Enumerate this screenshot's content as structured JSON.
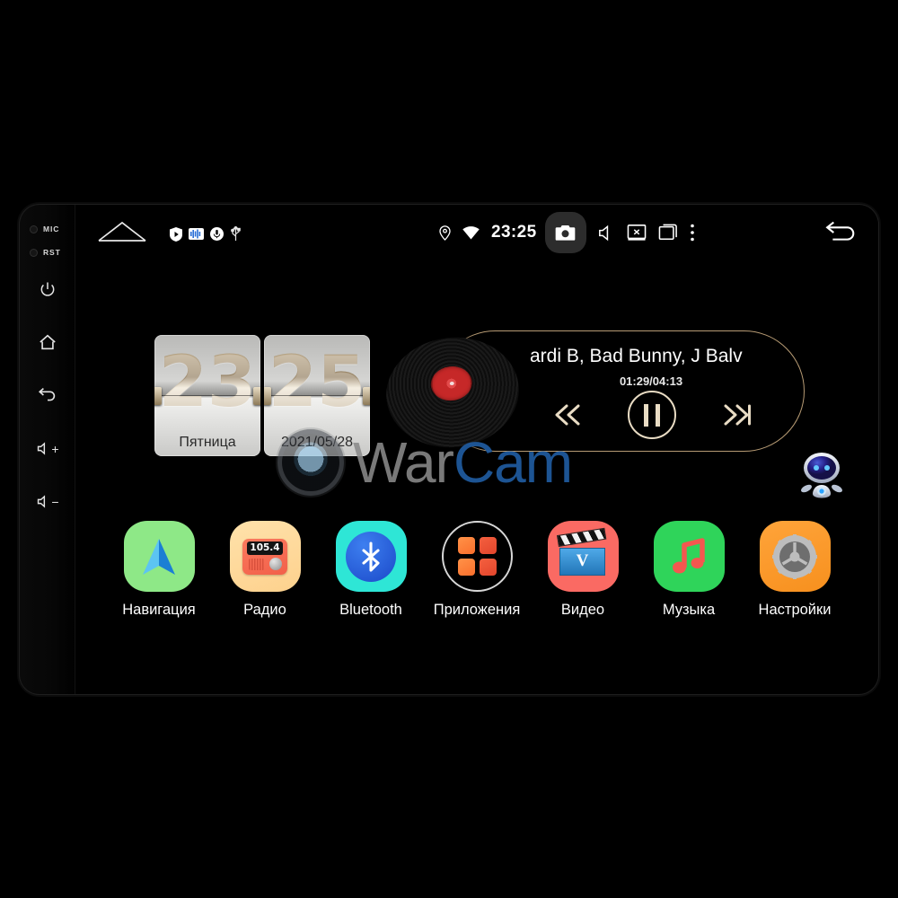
{
  "device": {
    "bezel": {
      "mic_label": "MIC",
      "rst_label": "RST",
      "buttons": [
        {
          "name": "power",
          "glyph": "power-icon"
        },
        {
          "name": "home",
          "glyph": "home-icon"
        },
        {
          "name": "back",
          "glyph": "back-icon"
        },
        {
          "name": "volume-up",
          "glyph": "volume-up-icon",
          "text": "+"
        },
        {
          "name": "volume-down",
          "glyph": "volume-down-icon",
          "text": "−"
        }
      ]
    }
  },
  "statusbar": {
    "tray_icons": [
      "play-shield-icon",
      "equalizer-radio-icon",
      "microphone-icon",
      "usb-icon"
    ],
    "location_icon": "location-pin-icon",
    "wifi_icon": "wifi-icon",
    "time": "23:25",
    "camera_icon": "camera-icon",
    "volume_icon": "speaker-icon",
    "screen_off_icon": "screen-off-icon",
    "recents_icon": "recents-icon",
    "overflow_icon": "more-vertical-icon",
    "back_icon": "back-arrow-icon"
  },
  "clock": {
    "hours": "23",
    "minutes": "25",
    "weekday": "Пятница",
    "date": "2021/05/28"
  },
  "music": {
    "title": "ardi B, Bad Bunny, J Balv",
    "position": "01:29",
    "duration": "04:13",
    "time_display": "01:29/04:13",
    "prev_icon": "previous-track-icon",
    "play_icon": "pause-icon",
    "next_icon": "next-track-icon",
    "accent_color": "#b79b74"
  },
  "assistant": {
    "icon": "robot-assistant-icon"
  },
  "watermark": {
    "text_part1": "War",
    "text_part2": "Cam",
    "color1": "#8a8a8a",
    "color2": "#1f5ba0",
    "logo": "camera-lens-icon"
  },
  "dock": {
    "apps": [
      {
        "label": "Навигация",
        "icon": "navigation-icon",
        "bg": "#8ee887"
      },
      {
        "label": "Радио",
        "icon": "radio-icon",
        "bg": "#ffe2ab",
        "display": "105.4"
      },
      {
        "label": "Bluetooth",
        "icon": "bluetooth-icon",
        "bg": "#2ee6d6"
      },
      {
        "label": "Приложения",
        "icon": "apps-grid-icon",
        "bg": "transparent"
      },
      {
        "label": "Видео",
        "icon": "video-clapper-icon",
        "bg": "#fa6a63",
        "letter": "V"
      },
      {
        "label": "Музыка",
        "icon": "music-note-icon",
        "bg": "#2fd45a"
      },
      {
        "label": "Настройки",
        "icon": "settings-gear-icon",
        "bg": "#ffa43a"
      }
    ]
  }
}
